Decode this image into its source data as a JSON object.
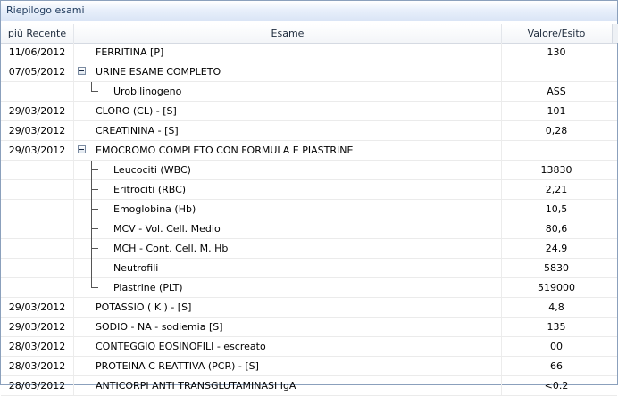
{
  "panel": {
    "title": "Riepilogo esami"
  },
  "columns": {
    "date": "più Recente",
    "exam": "Esame",
    "value": "Valore/Esito"
  },
  "rows": [
    {
      "date": "11/06/2012",
      "exam": "FERRITINA [P]",
      "value": "130",
      "kind": "plain"
    },
    {
      "date": "07/05/2012",
      "exam": "URINE ESAME COMPLETO",
      "value": "",
      "kind": "group"
    },
    {
      "date": "",
      "exam": "Urobilinogeno",
      "value": "ASS",
      "kind": "child-last"
    },
    {
      "date": "29/03/2012",
      "exam": "CLORO (CL) - [S]",
      "value": "101",
      "kind": "plain"
    },
    {
      "date": "29/03/2012",
      "exam": "CREATININA - [S]",
      "value": "0,28",
      "kind": "plain"
    },
    {
      "date": "29/03/2012",
      "exam": "EMOCROMO COMPLETO CON FORMULA E PIASTRINE",
      "value": "",
      "kind": "group"
    },
    {
      "date": "",
      "exam": "Leucociti (WBC)",
      "value": "13830",
      "kind": "child"
    },
    {
      "date": "",
      "exam": "Eritrociti (RBC)",
      "value": "2,21",
      "kind": "child"
    },
    {
      "date": "",
      "exam": "Emoglobina (Hb)",
      "value": "10,5",
      "kind": "child"
    },
    {
      "date": "",
      "exam": "MCV - Vol. Cell. Medio",
      "value": "80,6",
      "kind": "child"
    },
    {
      "date": "",
      "exam": "MCH - Cont. Cell. M. Hb",
      "value": "24,9",
      "kind": "child"
    },
    {
      "date": "",
      "exam": "Neutrofili",
      "value": "5830",
      "kind": "child"
    },
    {
      "date": "",
      "exam": "Piastrine (PLT)",
      "value": "519000",
      "kind": "child-last"
    },
    {
      "date": "29/03/2012",
      "exam": "POTASSIO ( K ) - [S]",
      "value": "4,8",
      "kind": "plain"
    },
    {
      "date": "29/03/2012",
      "exam": "SODIO - NA - sodiemia [S]",
      "value": "135",
      "kind": "plain"
    },
    {
      "date": "28/03/2012",
      "exam": "CONTEGGIO EOSINOFILI - escreato",
      "value": "00",
      "kind": "plain"
    },
    {
      "date": "28/03/2012",
      "exam": "PROTEINA C REATTIVA (PCR) - [S]",
      "value": "66",
      "kind": "plain"
    },
    {
      "date": "28/03/2012",
      "exam": "ANTICORPI ANTI TRANSGLUTAMINASI IgA",
      "value": "<0.2",
      "kind": "plain"
    }
  ]
}
